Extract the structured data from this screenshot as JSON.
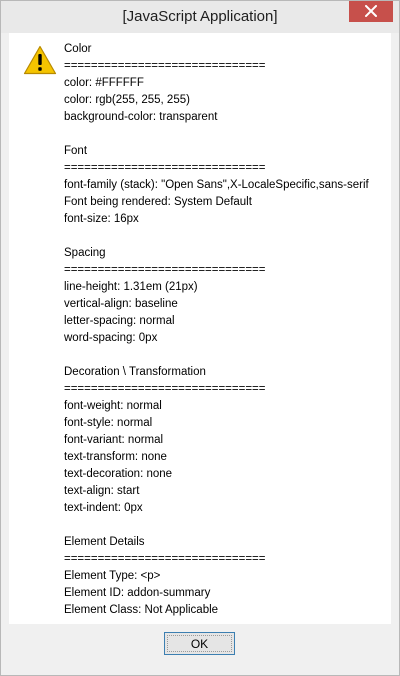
{
  "window": {
    "title": "[JavaScript Application]"
  },
  "dialog": {
    "icon": "warning-icon",
    "sections": [
      {
        "heading": "Color",
        "separator": "==============================",
        "lines": [
          "color: #FFFFFF",
          "color: rgb(255, 255, 255)",
          "background-color: transparent"
        ]
      },
      {
        "heading": "Font",
        "separator": "==============================",
        "lines": [
          "font-family (stack): \"Open Sans\",X-LocaleSpecific,sans-serif",
          "Font being rendered: System Default",
          "font-size: 16px"
        ]
      },
      {
        "heading": "Spacing",
        "separator": "==============================",
        "lines": [
          "line-height: 1.31em (21px)",
          "vertical-align: baseline",
          "letter-spacing: normal",
          "word-spacing: 0px"
        ]
      },
      {
        "heading": "Decoration \\ Transformation",
        "separator": "==============================",
        "lines": [
          "font-weight: normal",
          "font-style: normal",
          "font-variant: normal",
          "text-transform: none",
          "text-decoration: none",
          "text-align: start",
          "text-indent: 0px"
        ]
      },
      {
        "heading": "Element Details",
        "separator": "==============================",
        "lines": [
          "Element Type: <p>",
          "Element ID: addon-summary",
          "Element Class: Not Applicable"
        ]
      }
    ],
    "ok_label": "OK"
  },
  "colors": {
    "close_button": "#c7504b",
    "warning_fill": "#f5c400",
    "ok_border": "#3c7fb1"
  }
}
